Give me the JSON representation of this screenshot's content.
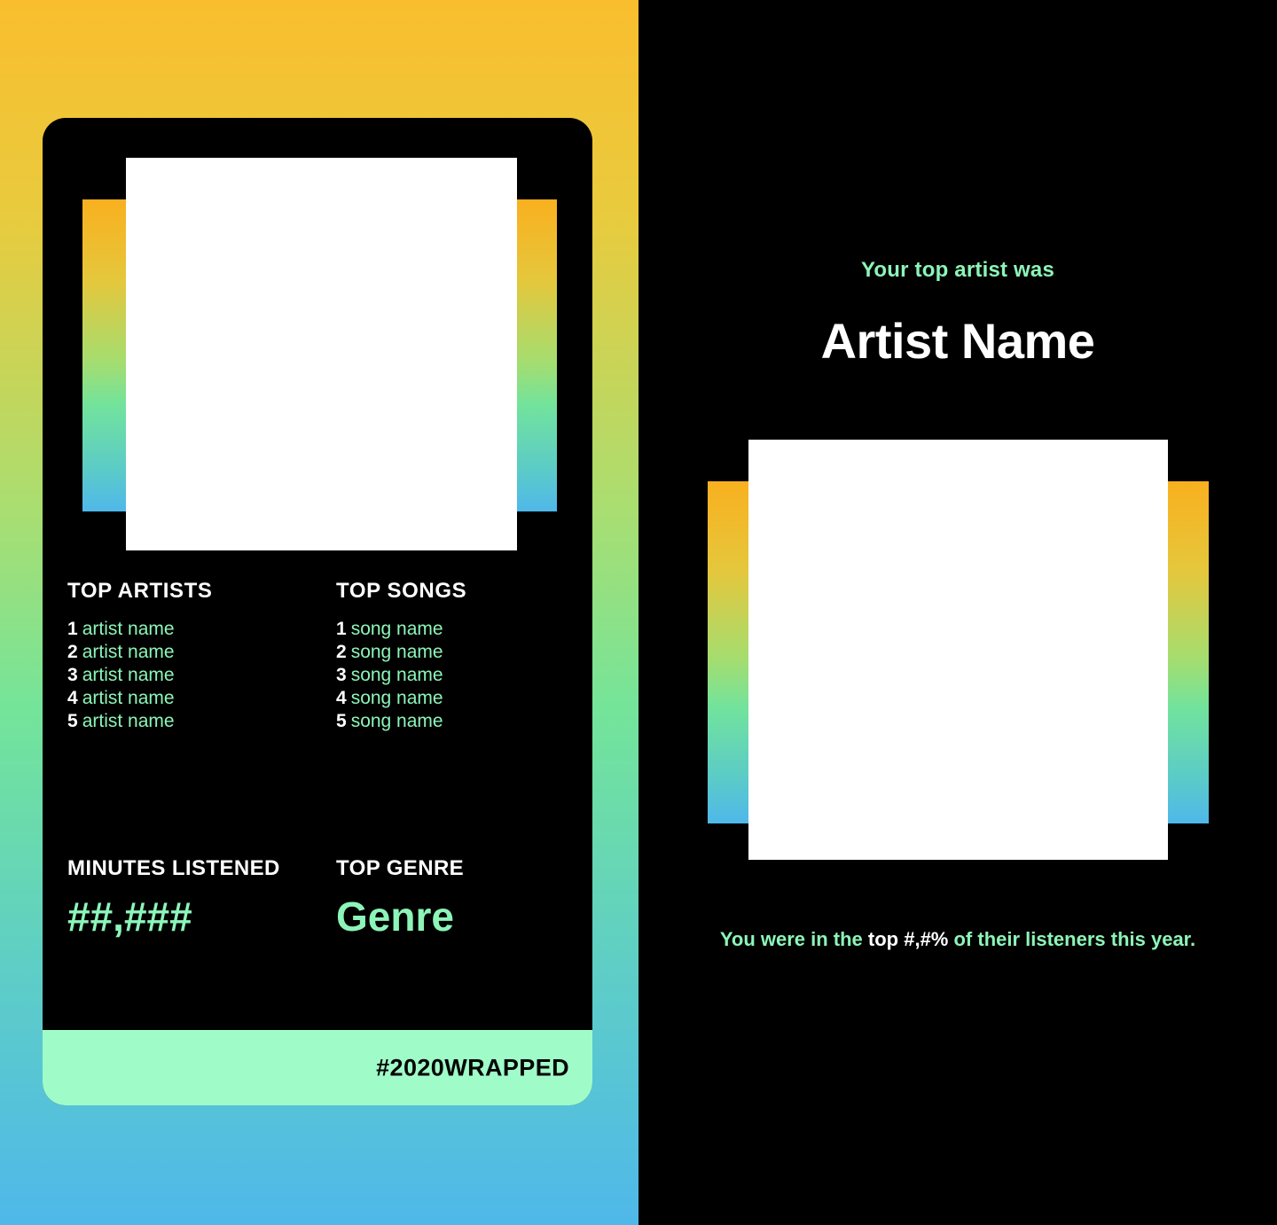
{
  "theme": {
    "background_gradient_top": "#F9BE2E",
    "background_gradient_bottom": "#4FB8EA",
    "accent_mint": "#8CF5B8",
    "footer_mint": "#9FFCC8",
    "card_background": "#000000",
    "text_white": "#FFFFFF"
  },
  "story_card": {
    "album_art": "album-art-placeholder",
    "columns": {
      "top_artists": {
        "heading": "TOP ARTISTS",
        "items": [
          {
            "rank": "1",
            "name": "artist name"
          },
          {
            "rank": "2",
            "name": "artist name"
          },
          {
            "rank": "3",
            "name": "artist name"
          },
          {
            "rank": "4",
            "name": "artist name"
          },
          {
            "rank": "5",
            "name": "artist name"
          }
        ]
      },
      "top_songs": {
        "heading": "TOP SONGS",
        "items": [
          {
            "rank": "1",
            "name": "song name"
          },
          {
            "rank": "2",
            "name": "song name"
          },
          {
            "rank": "3",
            "name": "song name"
          },
          {
            "rank": "4",
            "name": "song name"
          },
          {
            "rank": "5",
            "name": "song name"
          }
        ]
      }
    },
    "stats": {
      "minutes": {
        "label": "MINUTES LISTENED",
        "value": "##,###"
      },
      "genre": {
        "label": "TOP GENRE",
        "value": "Genre"
      }
    },
    "footer": {
      "hashtag": "#2020WRAPPED"
    }
  },
  "artist_panel": {
    "eyebrow": "Your top artist was",
    "artist_name": "Artist Name",
    "artist_art": "artist-art-placeholder",
    "listener_note": {
      "lead": "You were in the ",
      "highlight": "top #,#%",
      "tail": " of their listeners this year."
    }
  }
}
